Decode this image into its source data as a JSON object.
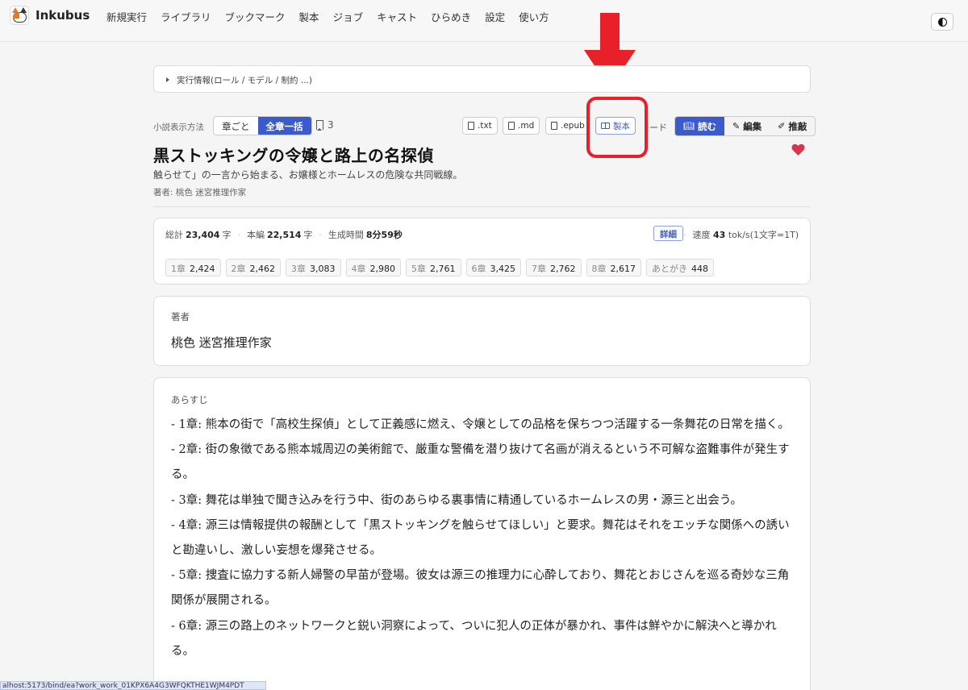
{
  "app": {
    "name": "Inkubus"
  },
  "nav": [
    "新規実行",
    "ライブラリ",
    "ブックマーク",
    "製本",
    "ジョブ",
    "キャスト",
    "ひらめき",
    "設定",
    "使い方"
  ],
  "run_info": {
    "label": "実行情報(ロール / モデル / 制約 ...)"
  },
  "display": {
    "label": "小説表示方法",
    "options": [
      "章ごと",
      "全章一括"
    ],
    "selected": "全章一括",
    "bookmark_count": "3"
  },
  "exports": {
    "txt": ".txt",
    "md": ".md",
    "epub": ".epub",
    "bind": "製本"
  },
  "mode": {
    "label": "モード",
    "visible_label": "モード",
    "options": [
      "読む",
      "編集",
      "推敲"
    ],
    "selected": "読む"
  },
  "novel": {
    "title": "黒ストッキングの令嬢と路上の名探偵",
    "subtitle": "触らせて」の一言から始まる、お嬢様とホームレスの危険な共同戦線。",
    "byline": "著者: 桃色 迷宮推理作家"
  },
  "stats": {
    "total_label": "総計",
    "total": "23,404",
    "total_unit": "字",
    "body_label": "本編",
    "body": "22,514",
    "body_unit": "字",
    "gen_label": "生成時間",
    "gen_time": "8分59秒",
    "detail_label": "詳細",
    "speed_label": "速度",
    "speed": "43",
    "speed_unit": "tok/s(1文字=1T)",
    "chapters": [
      {
        "label": "1章",
        "count": "2,424"
      },
      {
        "label": "2章",
        "count": "2,462"
      },
      {
        "label": "3章",
        "count": "3,083"
      },
      {
        "label": "4章",
        "count": "2,980"
      },
      {
        "label": "5章",
        "count": "2,761"
      },
      {
        "label": "6章",
        "count": "3,425"
      },
      {
        "label": "7章",
        "count": "2,762"
      },
      {
        "label": "8章",
        "count": "2,617"
      },
      {
        "label": "あとがき",
        "count": "448"
      }
    ]
  },
  "author": {
    "label": "著者",
    "name": "桃色 迷宮推理作家"
  },
  "synopsis": {
    "label": "あらすじ",
    "lines": [
      "- 1章: 熊本の街で「高校生探偵」として正義感に燃え、令嬢としての品格を保ちつつ活躍する一条舞花の日常を描く。",
      "- 2章: 街の象徴である熊本城周辺の美術館で、厳重な警備を潜り抜けて名画が消えるという不可解な盗難事件が発生する。",
      "- 3章: 舞花は単独で聞き込みを行う中、街のあらゆる裏事情に精通しているホームレスの男・源三と出会う。",
      "- 4章: 源三は情報提供の報酬として「黒ストッキングを触らせてほしい」と要求。舞花はそれをエッチな関係への誘いと勘違いし、激しい妄想を爆発させる。",
      "- 5章: 捜査に協力する新人婦警の早苗が登場。彼女は源三の推理力に心酔しており、舞花とおじさんを巡る奇妙な三角関係が展開される。",
      "- 6章: 源三の路上のネットワークと鋭い洞察によって、ついに犯人の正体が暴かれ、事件は鮮やかに解決へと導かれる。"
    ]
  },
  "status_url": "alhost:5173/bind/ea?work_work_01KPX6A4G3WFQKTHE1WJM4PDT",
  "colors": {
    "accent": "#3b5bcc",
    "annotation": "#e8202a",
    "heart": "#d8344e"
  }
}
